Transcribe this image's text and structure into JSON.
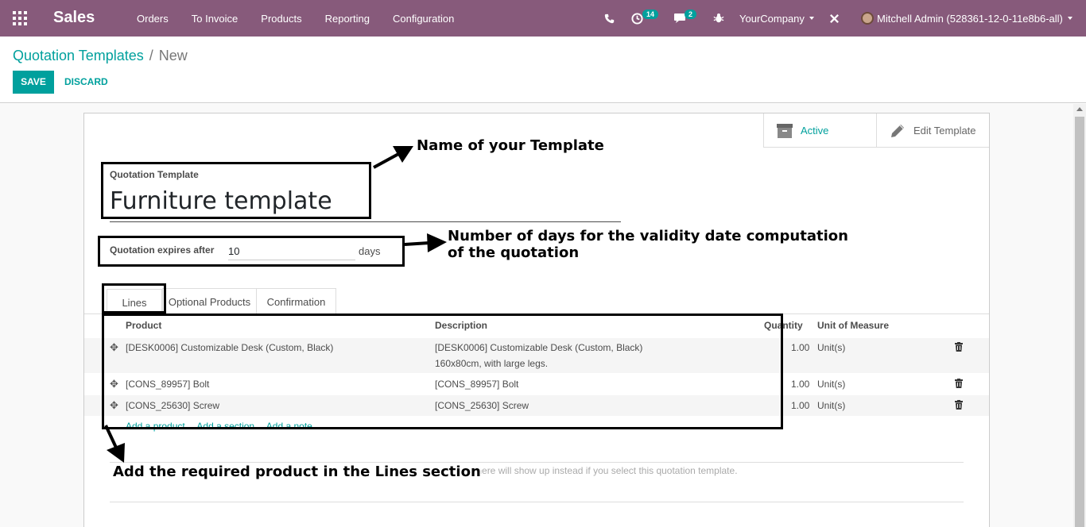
{
  "navbar": {
    "brand": "Sales",
    "menu": [
      "Orders",
      "To Invoice",
      "Products",
      "Reporting",
      "Configuration"
    ],
    "activities_count": "14",
    "messages_count": "2",
    "company": "YourCompany",
    "user": "Mitchell Admin (528361-12-0-11e8b6-all)"
  },
  "breadcrumb": {
    "parent": "Quotation Templates",
    "separator": "/",
    "current": "New"
  },
  "actions": {
    "save": "SAVE",
    "discard": "DISCARD"
  },
  "button_box": {
    "active": "Active",
    "edit": "Edit Template"
  },
  "form": {
    "title_label": "Quotation Template",
    "title_value": "Furniture template",
    "expires_label": "Quotation expires after",
    "expires_value": "10",
    "expires_unit": "days"
  },
  "tabs": [
    "Lines",
    "Optional Products",
    "Confirmation"
  ],
  "table": {
    "headers": {
      "product": "Product",
      "description": "Description",
      "quantity": "Quantity",
      "uom": "Unit of Measure"
    },
    "rows": [
      {
        "product": "[DESK0006] Customizable Desk (Custom, Black)",
        "description": "[DESK0006] Customizable Desk (Custom, Black)",
        "description2": "160x80cm, with large legs.",
        "quantity": "1.00",
        "uom": "Unit(s)"
      },
      {
        "product": "[CONS_89957] Bolt",
        "description": "[CONS_89957] Bolt",
        "quantity": "1.00",
        "uom": "Unit(s)"
      },
      {
        "product": "[CONS_25630] Screw",
        "description": "[CONS_25630] Screw",
        "quantity": "1.00",
        "uom": "Unit(s)"
      }
    ],
    "add_links": [
      "Add a product",
      "Add a section",
      "Add a note"
    ]
  },
  "note_placeholder": "set here will show up instead if you select this quotation template.",
  "annotations": {
    "name": "Name of your Template",
    "days_line1": "Number of days for the validity date computation",
    "days_line2": "of the quotation",
    "lines": "Add the required product in the Lines section"
  }
}
